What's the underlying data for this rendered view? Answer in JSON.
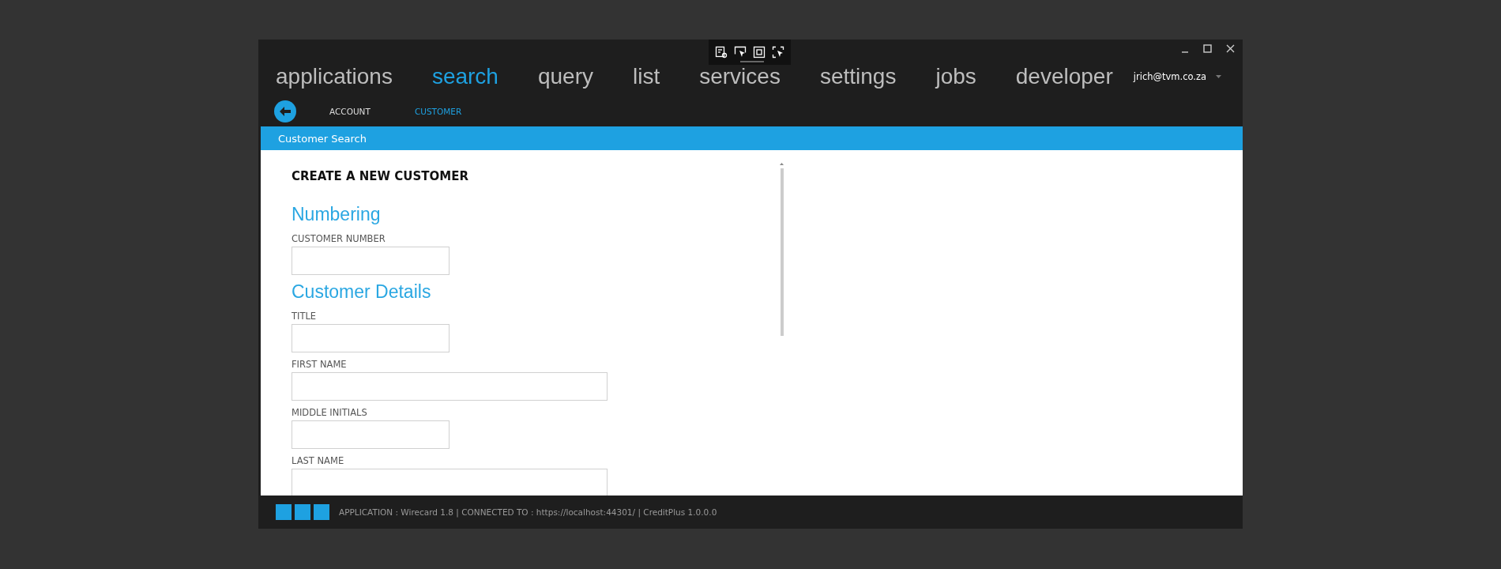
{
  "nav": [
    {
      "label": "applications",
      "selected": false
    },
    {
      "label": "search",
      "selected": true
    },
    {
      "label": "query",
      "selected": false
    },
    {
      "label": "list",
      "selected": false
    },
    {
      "label": "services",
      "selected": false
    },
    {
      "label": "settings",
      "selected": false
    },
    {
      "label": "jobs",
      "selected": false
    },
    {
      "label": "developer",
      "selected": false
    }
  ],
  "user": {
    "email": "jrich@tvm.co.za"
  },
  "subnav": [
    {
      "label": "ACCOUNT",
      "selected": false
    },
    {
      "label": "CUSTOMER",
      "selected": true
    }
  ],
  "page_title": "Customer Search",
  "form": {
    "heading": "CREATE A NEW CUSTOMER",
    "sections": [
      {
        "title": "Numbering",
        "fields": [
          {
            "label": "CUSTOMER NUMBER",
            "wide": false
          }
        ]
      },
      {
        "title": "Customer Details",
        "fields": [
          {
            "label": "TITLE",
            "wide": false
          },
          {
            "label": "FIRST NAME",
            "wide": true
          },
          {
            "label": "MIDDLE INITIALS",
            "wide": false
          },
          {
            "label": "LAST NAME",
            "wide": true
          }
        ]
      }
    ]
  },
  "status_bar": {
    "text": "APPLICATION : Wirecard 1.8 | CONNECTED TO : https://localhost:44301/ | CreditPlus 1.0.0.0"
  }
}
